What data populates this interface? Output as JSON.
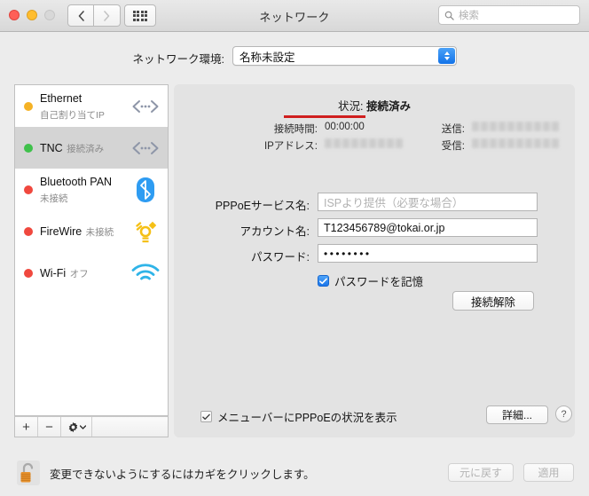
{
  "window": {
    "title": "ネットワーク",
    "traffic_lights": [
      "close",
      "minimize",
      "zoom-disabled"
    ],
    "nav": {
      "back": "‹",
      "forward": "›",
      "grid_icon": "grid-view-icon"
    },
    "search": {
      "placeholder": "検索",
      "icon": "search-icon"
    }
  },
  "environment": {
    "label": "ネットワーク環境:",
    "selected": "名称未設定"
  },
  "sidebar": {
    "items": [
      {
        "name": "Ethernet",
        "status": "自己割り当てIP",
        "dot": "yellow",
        "icon": "ethernet-pppoe-icon",
        "selected": false
      },
      {
        "name": "TNC",
        "status": "接続済み",
        "dot": "green",
        "icon": "ethernet-pppoe-icon",
        "selected": true
      },
      {
        "name": "Bluetooth PAN",
        "status": "未接続",
        "dot": "red",
        "icon": "bluetooth-icon",
        "selected": false
      },
      {
        "name": "FireWire",
        "status": "未接続",
        "dot": "red",
        "icon": "firewire-icon",
        "selected": false
      },
      {
        "name": "Wi-Fi",
        "status": "オフ",
        "dot": "red",
        "icon": "wifi-icon",
        "selected": false
      }
    ],
    "footer": {
      "add": "+",
      "remove": "−",
      "action": "gear-icon"
    }
  },
  "status": {
    "label": "状況:",
    "value": "接続済み",
    "annotation_color": "#d01f1f",
    "rows": [
      {
        "label": "接続時間:",
        "value": "00:00:00",
        "redacted": false
      },
      {
        "label": "IPアドレス:",
        "value": "",
        "redacted": true
      },
      {
        "label": "送信:",
        "value": "",
        "redacted": true
      },
      {
        "label": "受信:",
        "value": "",
        "redacted": true
      }
    ]
  },
  "form": {
    "service_name": {
      "label": "PPPoEサービス名:",
      "value": "",
      "placeholder": "ISPより提供（必要な場合）"
    },
    "account_name": {
      "label": "アカウント名:",
      "value": "T123456789@tokai.or.jp"
    },
    "password": {
      "label": "パスワード:",
      "value": "••••••••"
    },
    "remember": {
      "label": "パスワードを記憶",
      "checked": true
    },
    "disconnect_button": "接続解除"
  },
  "options": {
    "show_in_menubar": {
      "label": "メニューバーにPPPoEの状況を表示",
      "checked": true
    },
    "advanced_button": "詳細...",
    "help_button": "?"
  },
  "footer": {
    "lock_icon": "lock-open-icon",
    "lock_text": "変更できないようにするにはカギをクリックします。",
    "revert_button": "元に戻す",
    "apply_button": "適用"
  }
}
